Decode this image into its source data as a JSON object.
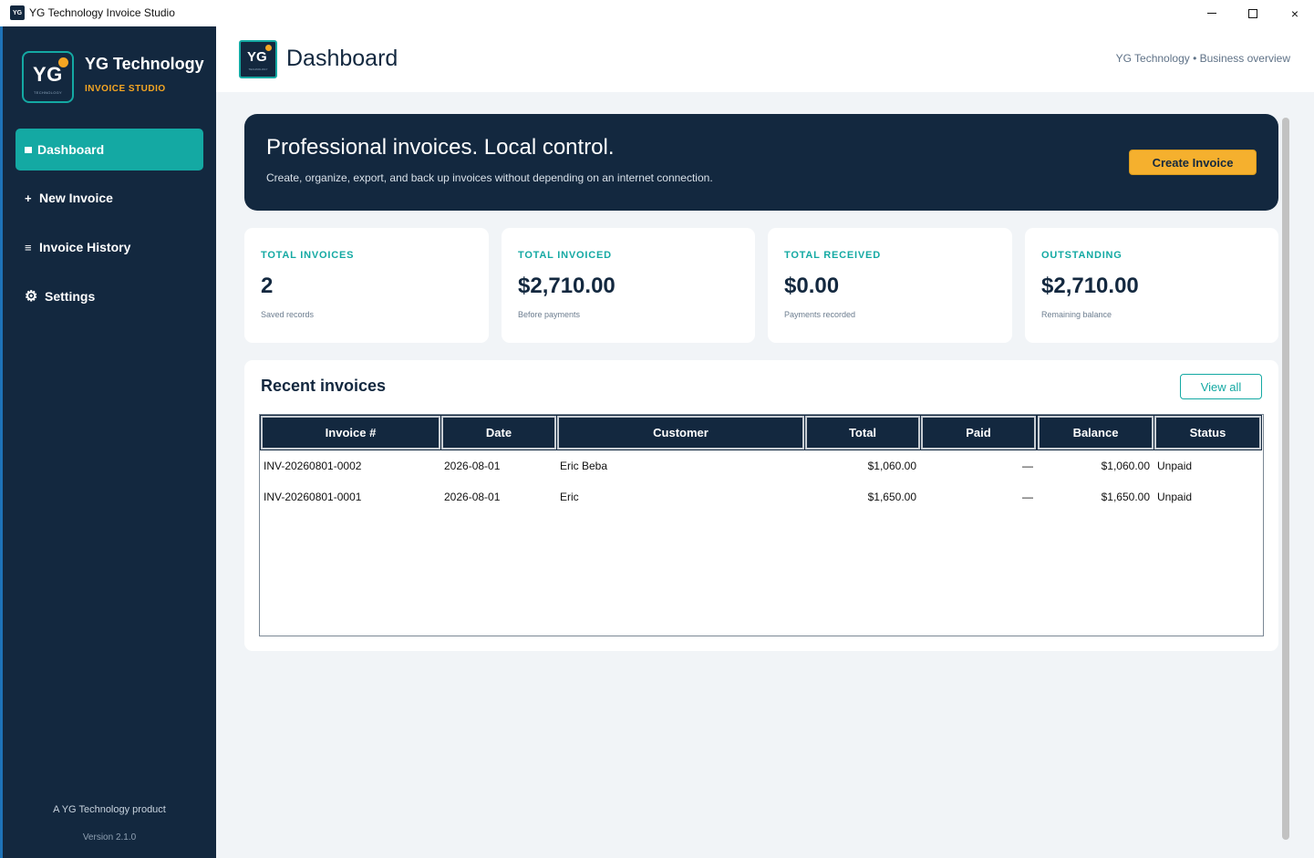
{
  "window": {
    "title": "YG Technology Invoice Studio",
    "icon_text": "YG",
    "minimize": "minimize-icon",
    "maximize": "maximize-icon",
    "close": "×"
  },
  "sidebar": {
    "logo_text": "YG",
    "logo_subtext": "TECHNOLOGY",
    "brand_name": "YG Technology",
    "brand_sub": "INVOICE STUDIO",
    "items": [
      {
        "label": "Dashboard",
        "icon": "square-icon",
        "active": true
      },
      {
        "label": "New Invoice",
        "icon": "plus-icon",
        "icon_glyph": "+"
      },
      {
        "label": "Invoice History",
        "icon": "list-icon",
        "icon_glyph": "≡"
      },
      {
        "label": "Settings",
        "icon": "gear-icon",
        "icon_glyph": "⚙"
      }
    ],
    "footer_product": "A YG Technology product",
    "footer_version": "Version 2.1.0"
  },
  "header": {
    "logo_text": "YG",
    "logo_subtext": "TECHNOLOGY",
    "title": "Dashboard",
    "right_text": "YG Technology • Business overview"
  },
  "hero": {
    "title": "Professional invoices. Local control.",
    "subtitle": "Create, organize, export, and back up invoices without depending on an internet connection.",
    "button": "Create Invoice"
  },
  "stats": [
    {
      "label": "TOTAL INVOICES",
      "value": "2",
      "hint": "Saved records"
    },
    {
      "label": "TOTAL INVOICED",
      "value": "$2,710.00",
      "hint": "Before payments"
    },
    {
      "label": "TOTAL RECEIVED",
      "value": "$0.00",
      "hint": "Payments recorded"
    },
    {
      "label": "OUTSTANDING",
      "value": "$2,710.00",
      "hint": "Remaining balance"
    }
  ],
  "recent": {
    "title": "Recent invoices",
    "view_all": "View all",
    "columns": [
      "Invoice #",
      "Date",
      "Customer",
      "Total",
      "Paid",
      "Balance",
      "Status"
    ],
    "rows": [
      [
        "INV-20260801-0002",
        "2026-08-01",
        "Eric Beba",
        "$1,060.00",
        "—",
        "$1,060.00",
        "Unpaid"
      ],
      [
        "INV-20260801-0001",
        "2026-08-01",
        "Eric",
        "$1,650.00",
        "—",
        "$1,650.00",
        "Unpaid"
      ]
    ]
  },
  "colors": {
    "navy": "#13283f",
    "teal": "#14a9a3",
    "amber": "#f5b02e",
    "background": "#f1f4f7"
  }
}
